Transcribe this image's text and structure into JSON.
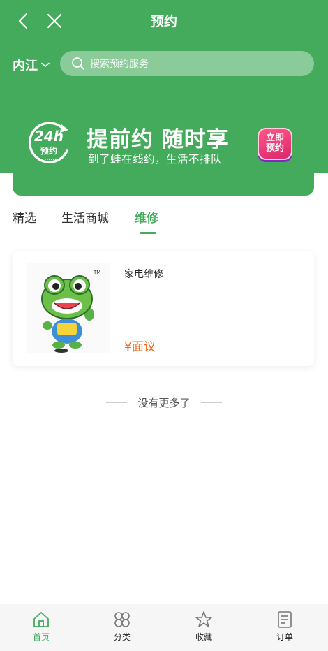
{
  "header": {
    "title": "预约",
    "city": "内江",
    "search_placeholder": "搜索预约服务"
  },
  "banner": {
    "slogan": "提前约 随时享",
    "subtitle": "到了蛙在线约，生活不排队",
    "badge_top": "24h",
    "badge_bottom": "预约",
    "book_line1": "立即",
    "book_line2": "预约"
  },
  "tabs": [
    {
      "label": "精选",
      "active": false
    },
    {
      "label": "生活商城",
      "active": false
    },
    {
      "label": "维修",
      "active": true
    }
  ],
  "products": [
    {
      "name": "家电维修",
      "price": "¥面议",
      "image": "frog-mascot"
    }
  ],
  "list_end_text": "没有更多了",
  "bottom_nav": [
    {
      "label": "首页",
      "icon": "home-icon",
      "active": true
    },
    {
      "label": "分类",
      "icon": "category-icon",
      "active": false
    },
    {
      "label": "收藏",
      "icon": "star-icon",
      "active": false
    },
    {
      "label": "订单",
      "icon": "order-icon",
      "active": false
    }
  ],
  "colors": {
    "brand_green": "#44ab5c",
    "price_orange": "#f06a1d",
    "book_pink": "#e63474"
  }
}
